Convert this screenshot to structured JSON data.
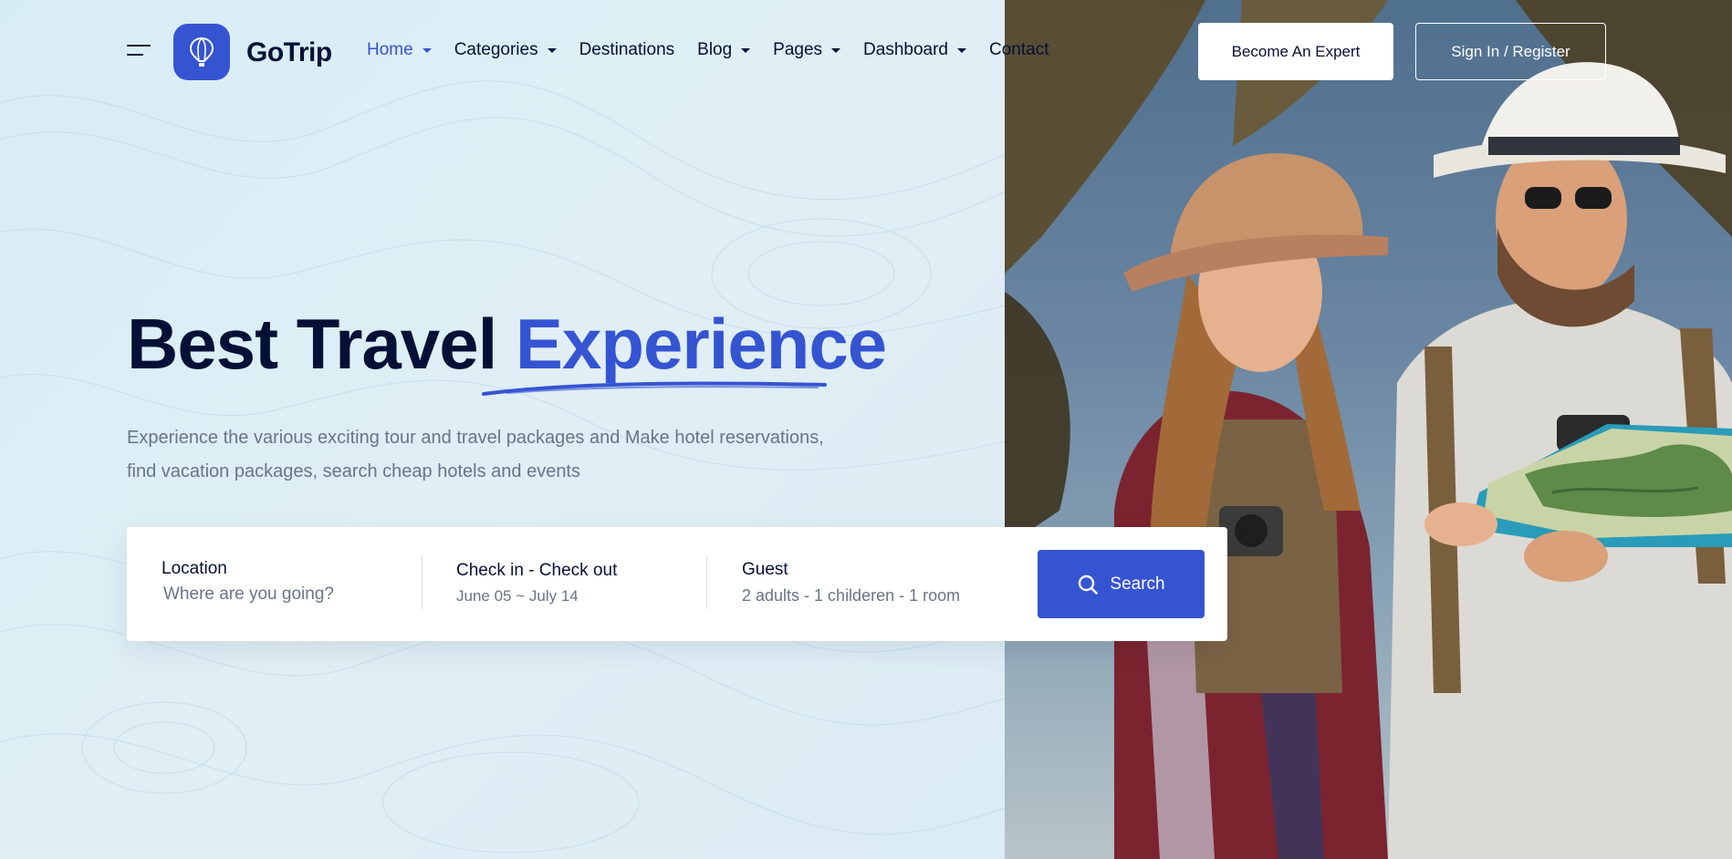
{
  "brand": {
    "name": "GoTrip",
    "accent_color": "#3554d1",
    "dark_color": "#051036"
  },
  "header": {
    "menu_icon": "hamburger-menu-icon",
    "logo_icon": "hot-air-balloon-icon",
    "nav": [
      {
        "label": "Home",
        "dropdown": true,
        "active": true
      },
      {
        "label": "Categories",
        "dropdown": true,
        "active": false
      },
      {
        "label": "Destinations",
        "dropdown": false,
        "active": false
      },
      {
        "label": "Blog",
        "dropdown": true,
        "active": false
      },
      {
        "label": "Pages",
        "dropdown": true,
        "active": false
      },
      {
        "label": "Dashboard",
        "dropdown": true,
        "active": false
      },
      {
        "label": "Contact",
        "dropdown": false,
        "active": false
      }
    ],
    "become_expert_label": "Become An Expert",
    "signin_label": "Sign In / Register"
  },
  "hero": {
    "title_plain": "Best Travel",
    "title_accent": "Experience",
    "subtitle": "Experience the various exciting tour and travel packages and Make hotel reservations, find vacation packages, search cheap hotels and events"
  },
  "search": {
    "location_label": "Location",
    "location_placeholder": "Where are you going?",
    "dates_label": "Check in - Check out",
    "dates_value": "June 05 ~ July 14",
    "guest_label": "Guest",
    "guest_value": "2 adults - 1 childeren - 1 room",
    "button_label": "Search",
    "button_icon": "search-icon"
  }
}
